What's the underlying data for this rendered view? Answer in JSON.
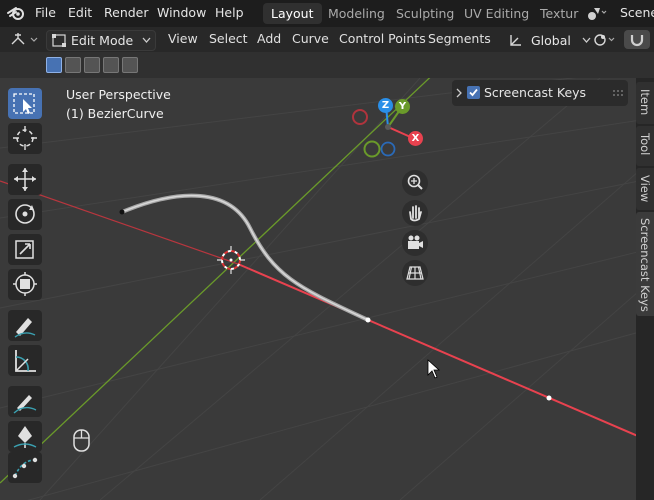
{
  "topbar": {
    "menus": [
      "File",
      "Edit",
      "Render",
      "Window",
      "Help"
    ],
    "workspaces": [
      "Layout",
      "Modeling",
      "Sculpting",
      "UV Editing",
      "Textur"
    ],
    "active_workspace": "Layout",
    "scene_label": "Scene"
  },
  "header": {
    "mode": "Edit Mode",
    "menus": [
      "View",
      "Select",
      "Add",
      "Curve",
      "Control Points",
      "Segments"
    ],
    "orientation": "Global"
  },
  "viewport": {
    "perspective_label": "User Perspective",
    "object_label": "(1) BezierCurve",
    "gizmo_axes": {
      "z": "Z",
      "y": "Y",
      "x": "X"
    }
  },
  "panel": {
    "screencast_label": "Screencast Keys",
    "screencast_enabled": true
  },
  "sidebar_tabs": [
    "Item",
    "Tool",
    "View",
    "Screencast Keys"
  ],
  "colors": {
    "x_axis": "#e8424f",
    "y_axis": "#6a9a2a",
    "z_axis": "#2a8fe8",
    "accent": "#4772b3"
  }
}
